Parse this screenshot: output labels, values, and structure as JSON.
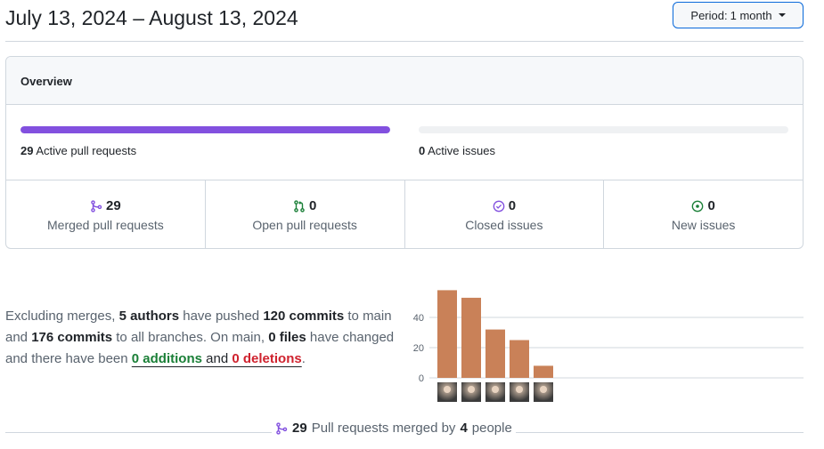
{
  "header": {
    "date_range": "July 13, 2024 – August 13, 2024",
    "period_label": "Period:",
    "period_value": "1 month"
  },
  "overview": {
    "title": "Overview",
    "active_prs": {
      "count": "29",
      "label": "Active pull requests",
      "fill_fraction": 1.0
    },
    "active_issues": {
      "count": "0",
      "label": "Active issues",
      "fill_fraction": 0.0
    },
    "stats": [
      {
        "count": "29",
        "label": "Merged pull requests",
        "icon": "git-merge-icon"
      },
      {
        "count": "0",
        "label": "Open pull requests",
        "icon": "git-pull-request-icon"
      },
      {
        "count": "0",
        "label": "Closed issues",
        "icon": "issue-closed-icon"
      },
      {
        "count": "0",
        "label": "New issues",
        "icon": "issue-opened-icon"
      }
    ],
    "colors": {
      "merged": "#8250df",
      "open": "#1a7f37",
      "closed": "#8250df",
      "new": "#1a7f37"
    }
  },
  "summary": {
    "p1": "Excluding merges, ",
    "authors": "5 authors",
    "p2": " have pushed ",
    "commits_main": "120 commits",
    "p3": " to main and ",
    "commits_all": "176 commits",
    "p4": " to all branches. On main, ",
    "files": "0 files",
    "p5": " have changed and there have been ",
    "additions": "0 additions",
    "p6": " and ",
    "deletions": "0 deletions",
    "p7": "."
  },
  "chart_data": {
    "type": "bar",
    "values": [
      58,
      53,
      32,
      25,
      8
    ],
    "yticks": [
      "0",
      "20",
      "40"
    ],
    "ylim": [
      0,
      58
    ],
    "bar_color": "#c98158",
    "grid": true
  },
  "merged_footer": {
    "count": "29",
    "text1": "Pull requests merged by",
    "people": "4",
    "text2": "people"
  }
}
